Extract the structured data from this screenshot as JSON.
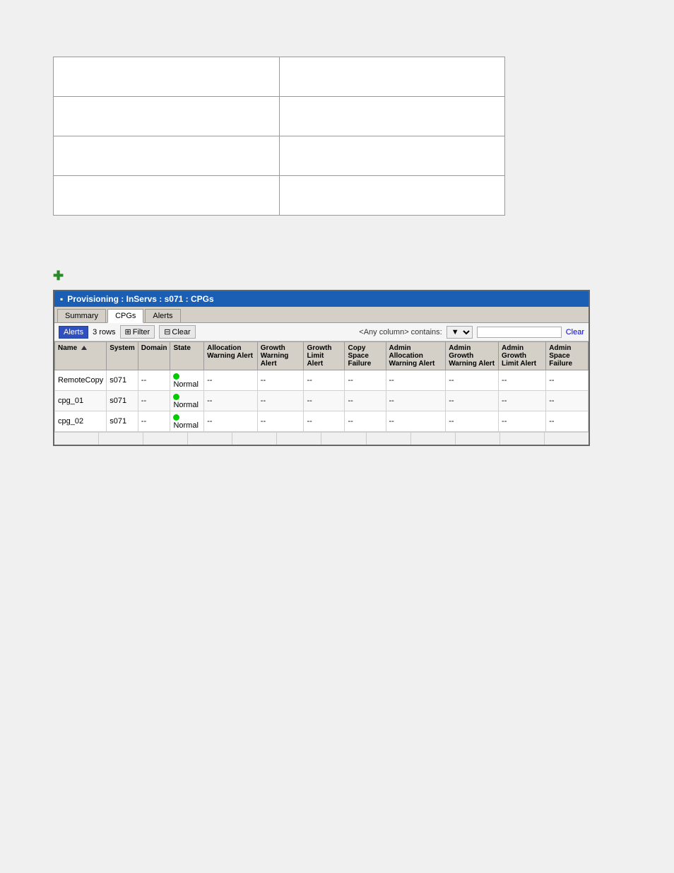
{
  "top_grid": {
    "rows": [
      [
        {
          "content": ""
        },
        {
          "content": ""
        }
      ],
      [
        {
          "content": ""
        },
        {
          "content": ""
        }
      ],
      [
        {
          "content": ""
        },
        {
          "content": ""
        }
      ],
      [
        {
          "content": ""
        },
        {
          "content": ""
        }
      ]
    ]
  },
  "plus_icon": {
    "symbol": "✚",
    "color": "#2a8a2a"
  },
  "panel": {
    "title": "Provisioning : InServs : s071 : CPGs",
    "title_icon": "▪",
    "tabs": [
      {
        "label": "Summary",
        "active": false
      },
      {
        "label": "CPGs",
        "active": true
      },
      {
        "label": "Alerts",
        "active": false
      }
    ],
    "toolbar": {
      "dropdown_label": "Alerts",
      "count_text": "3 rows",
      "filter_btn": "Filter",
      "clear_btn": "Clear",
      "filter_placeholder": "<Any column> contains:",
      "filter_dropdown_option": "▼",
      "search_value": "",
      "clear_link": "Clear"
    },
    "table": {
      "columns": [
        {
          "label": "Name",
          "sortable": true,
          "sort_dir": "asc"
        },
        {
          "label": "System",
          "sortable": false
        },
        {
          "label": "Domain",
          "sortable": false
        },
        {
          "label": "State",
          "sortable": false
        },
        {
          "label": "Allocation Warning Alert",
          "sortable": false
        },
        {
          "label": "Growth Warning Alert",
          "sortable": false
        },
        {
          "label": "Growth Limit Alert",
          "sortable": false
        },
        {
          "label": "Copy Space Failure",
          "sortable": false
        },
        {
          "label": "Admin Allocation Warning Alert",
          "sortable": false
        },
        {
          "label": "Admin Growth Warning Alert",
          "sortable": false
        },
        {
          "label": "Admin Growth Limit Alert",
          "sortable": false
        },
        {
          "label": "Admin Space Failure",
          "sortable": false
        }
      ],
      "rows": [
        {
          "name": "RemoteCopy",
          "system": "s071",
          "domain": "--",
          "state": "Normal",
          "state_color": "#00cc00",
          "allocation_warning": "--",
          "growth_warning": "--",
          "growth_limit": "--",
          "copy_space": "--",
          "admin_alloc": "--",
          "admin_growth": "--",
          "admin_growth_limit": "--",
          "admin_space": "--"
        },
        {
          "name": "cpg_01",
          "system": "s071",
          "domain": "--",
          "state": "Normal",
          "state_color": "#00cc00",
          "allocation_warning": "--",
          "growth_warning": "--",
          "growth_limit": "--",
          "copy_space": "--",
          "admin_alloc": "--",
          "admin_growth": "--",
          "admin_growth_limit": "--",
          "admin_space": "--"
        },
        {
          "name": "cpg_02",
          "system": "s071",
          "domain": "--",
          "state": "Normal",
          "state_color": "#00cc00",
          "allocation_warning": "--",
          "growth_warning": "--",
          "growth_limit": "--",
          "copy_space": "--",
          "admin_alloc": "--",
          "admin_growth": "--",
          "admin_growth_limit": "--",
          "admin_space": "--"
        }
      ]
    },
    "status_cells": [
      "",
      "",
      "",
      "",
      "",
      "",
      "",
      "",
      "",
      "",
      "",
      ""
    ]
  }
}
